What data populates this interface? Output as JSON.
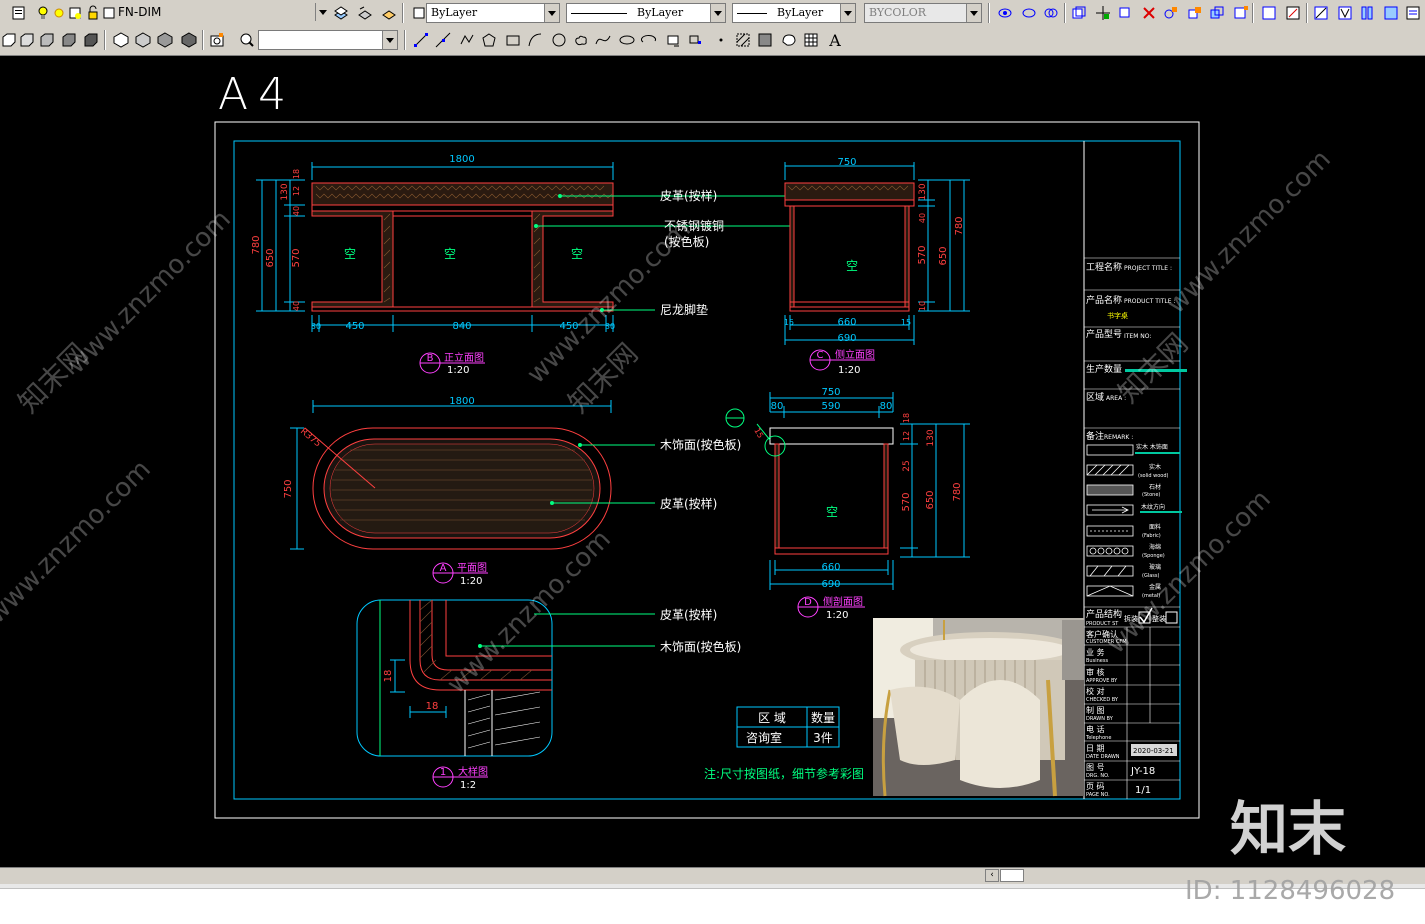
{
  "toolbar_top": {
    "layer_name": "FN-DIM",
    "color_combo": "ByLayer",
    "linetype_combo": "ByLayer",
    "lineweight_combo": "ByLayer",
    "plotstyle_combo": "BYCOLOR"
  },
  "toolbar_second": {
    "text_tool": "A"
  },
  "drawing": {
    "paper_label": "A4",
    "dims": {
      "front_width": "1800",
      "front_left": "450",
      "front_mid": "840",
      "front_right": "450",
      "front_edge_left": "30",
      "front_edge_right": "30",
      "h_780": "780",
      "h_650": "650",
      "h_570": "570",
      "h_130": "130",
      "h_40": "40",
      "h_12": "12",
      "h_18": "18",
      "h_10": "10",
      "side_width": "750",
      "side_660": "660",
      "side_690": "690",
      "side_15": "15",
      "plan_width": "1800",
      "plan_depth": "750",
      "plan_r": "R375",
      "sec_750": "750",
      "sec_80a": "80",
      "sec_590": "590",
      "sec_80b": "80",
      "sec_25": "25",
      "detail_18a": "18",
      "detail_18b": "18"
    },
    "void_label": "空",
    "callouts": {
      "leather": "皮革(按样)",
      "steel": "不锈钢镀铜",
      "steel_sub": "(按色板)",
      "nylon": "尼龙脚垫",
      "wood": "木饰面(按色板)",
      "leather2": "皮革(按样)",
      "leather3": "皮革(按样)",
      "wood2": "木饰面(按色板)"
    },
    "view_titles": {
      "front": {
        "letter": "B",
        "name": "正立面图",
        "scale": "1:20"
      },
      "side": {
        "letter": "C",
        "name": "侧立面图",
        "scale": "1:20"
      },
      "plan": {
        "letter": "A",
        "name": "平面图",
        "scale": "1:20"
      },
      "section": {
        "letter": "D",
        "name": "侧剖面图",
        "scale": "1:20"
      },
      "detail": {
        "letter": "1",
        "name": "大样图",
        "scale": "1:2"
      }
    },
    "qty_table": {
      "h1": "区  域",
      "h2": "数量",
      "v1": "咨询室",
      "v2": "3件"
    },
    "note": "注:尺寸按图纸，细节参考彩图",
    "title_block": {
      "project_title": "工程名称",
      "project_title_en": "PROJECT TITLE :",
      "product_name": "产品名称",
      "product_name_en": "PRODUCT TITLE :",
      "product_name_val": "书字桌",
      "product_no": "产品型号",
      "product_no_en": "ITEM NO:",
      "prod_qty": "生产数量",
      "area": "区域",
      "area_en": "AREA :",
      "remark": "备注",
      "remark_en": "REMARK :",
      "mat1": "实木 木饰面",
      "mat2": "实木",
      "mat2_en": "(solid wood)",
      "mat3": "石材",
      "mat3_en": "(Stone)",
      "mat4": "木纹方向",
      "mat5": "面料",
      "mat5_en": "(Fabric)",
      "mat6": "海绵",
      "mat6_en": "(Sponge)",
      "mat7": "玻璃",
      "mat7_en": "(Glass)",
      "mat8": "金属",
      "mat8_en": "(metal)",
      "structure": "产品结构",
      "structure_en": "PRODUCT ST",
      "struct_opt1": "拆装",
      "struct_opt2": "整装",
      "r1": "客户确认",
      "r1_en": "CUSTOMER CFM",
      "r2": "业    务",
      "r2_en": "Business",
      "r3": "审    核",
      "r3_en": "APPROVE BY",
      "r4": "校    对",
      "r4_en": "CHECKED BY",
      "r5": "制    图",
      "r5_en": "DRAWN BY",
      "r6": "电    话",
      "r6_en": "Telephone",
      "date": "日    期",
      "date_en": "DATE DRAWN",
      "date_val": "2020-03-21",
      "drg_no": "图    号",
      "drg_no_en": "DRG. NO.",
      "drg_no_val": "JY-18",
      "page": "页    码",
      "page_en": "PAGE NO.",
      "page_val": "1/1"
    }
  },
  "watermarks": {
    "url": "www.znzmo.com",
    "brand": "知末网",
    "logo": "知末",
    "id": "ID: 1128496028"
  },
  "colors": {
    "toolbar_bg": "#d4d0c8",
    "canvas_bg": "#000000",
    "dim_cyan": "#00c8ff",
    "outline_red": "#ff4040",
    "label_green": "#00ff80",
    "text_white": "#ffffff",
    "title_magenta": "#ff40ff"
  }
}
